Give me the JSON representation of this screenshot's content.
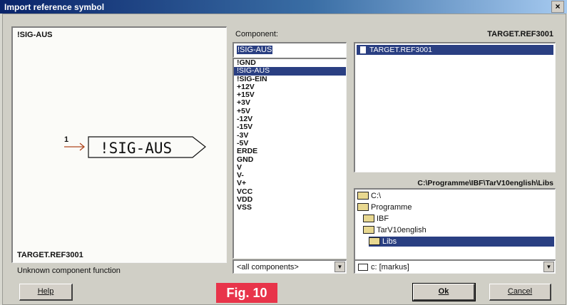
{
  "window": {
    "title": "Import reference symbol",
    "close_glyph": "×"
  },
  "preview": {
    "component_name": "!SIG-AUS",
    "symbol_label": "!SIG-AUS",
    "pin_number": "1",
    "reference": "TARGET.REF3001",
    "status": "Unknown component function"
  },
  "component": {
    "label": "Component:",
    "input_value": "!SIG-AUS",
    "items": [
      "!GND",
      "!SIG-AUS",
      "!SIG-EIN",
      "+12V",
      "+15V",
      "+3V",
      "+5V",
      "-12V",
      "-15V",
      "-3V",
      "-5V",
      "ERDE",
      "GND",
      "V",
      "V-",
      "V+",
      "VCC",
      "VDD",
      "VSS"
    ],
    "selected_index": 1,
    "filter_value": "<all components>"
  },
  "library": {
    "label": "TARGET.REF3001",
    "files": [
      "TARGET.REF3001"
    ],
    "path": "C:\\Programme\\IBF\\TarV10english\\Libs",
    "dirs": [
      {
        "label": "C:\\",
        "depth": 0
      },
      {
        "label": "Programme",
        "depth": 0
      },
      {
        "label": "IBF",
        "depth": 1
      },
      {
        "label": "TarV10english",
        "depth": 1
      },
      {
        "label": "Libs",
        "depth": 2
      }
    ],
    "drive_value": "c: [markus]"
  },
  "buttons": {
    "help": "Help",
    "ok": "Ok",
    "cancel": "Cancel"
  },
  "caption": "Fig. 10",
  "colors": {
    "selection": "#2a3f82",
    "caption_bg": "#e8344a"
  }
}
